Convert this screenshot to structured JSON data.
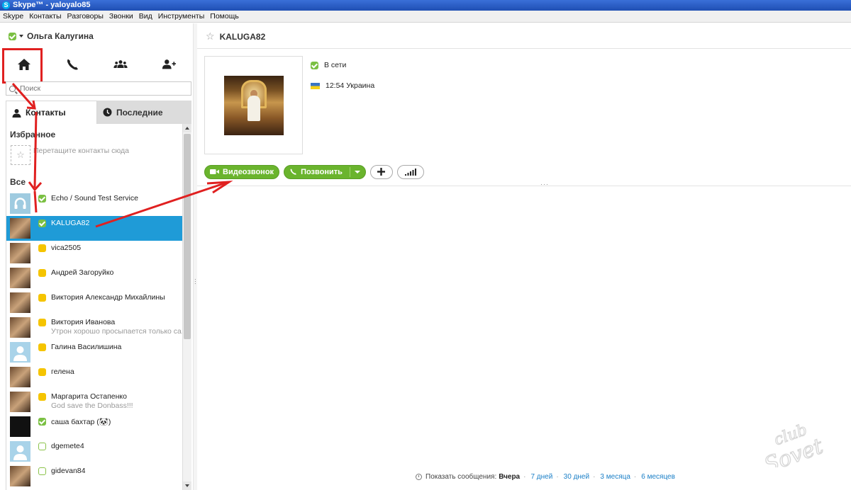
{
  "window": {
    "title": "Skype™ - yaloyalo85"
  },
  "menu": [
    "Skype",
    "Контакты",
    "Разговоры",
    "Звонки",
    "Вид",
    "Инструменты",
    "Помощь"
  ],
  "profile": {
    "name": "Ольга Калугина",
    "status": "online"
  },
  "nav": [
    {
      "id": "home",
      "icon": "home-icon"
    },
    {
      "id": "call",
      "icon": "phone-icon"
    },
    {
      "id": "groups",
      "icon": "group-icon"
    },
    {
      "id": "add",
      "icon": "add-contact-icon"
    }
  ],
  "search": {
    "placeholder": "Поиск"
  },
  "tabs": {
    "contacts": "Контакты",
    "recent": "Последние"
  },
  "favorites": {
    "title": "Избранное",
    "hint": "Перетащите контакты сюда"
  },
  "all_title": "Все",
  "contacts": [
    {
      "name": "Echo / Sound Test Service",
      "mood": "",
      "status": "online",
      "avatar": "headset"
    },
    {
      "name": "KALUGA82",
      "mood": "",
      "status": "online",
      "avatar": "photo",
      "selected": true
    },
    {
      "name": "vica2505",
      "mood": "",
      "status": "away",
      "avatar": "photo"
    },
    {
      "name": "Андрей Загоруйко",
      "mood": "",
      "status": "away",
      "avatar": "photo"
    },
    {
      "name": "Виктория Александр  Михайлины",
      "mood": "",
      "status": "away",
      "avatar": "photo"
    },
    {
      "name": "Виктория Иванова",
      "mood": "Утрон хорошо просыпается только са...",
      "status": "away",
      "avatar": "photo"
    },
    {
      "name": "Галина Василишина",
      "mood": "",
      "status": "away",
      "avatar": "default"
    },
    {
      "name": "гелена",
      "mood": "",
      "status": "away",
      "avatar": "photo"
    },
    {
      "name": "Маргарита Остапенко",
      "mood": "God save the Donbass!!!",
      "status": "away",
      "avatar": "photo"
    },
    {
      "name": "саша бахтар (🐼)",
      "mood": "",
      "status": "online",
      "avatar": "dark"
    },
    {
      "name": "dgemete4",
      "mood": "",
      "status": "offline",
      "avatar": "default"
    },
    {
      "name": "gidevan84",
      "mood": "",
      "status": "offline",
      "avatar": "photo"
    }
  ],
  "chat": {
    "title": "KALUGA82",
    "presence": "В сети",
    "local_time": "12:54 Украина",
    "video_button": "Видеозвонок",
    "call_button": "Позвонить"
  },
  "history": {
    "label": "Показать сообщения:",
    "current": "Вчера",
    "options": [
      "7 дней",
      "30 дней",
      "3 месяца",
      "6 месяцев"
    ]
  },
  "watermark": "club Sovet",
  "colors": {
    "accent_blue": "#1f9bd7",
    "online_green": "#7bc043",
    "away_yellow": "#f5c400",
    "button_green": "#6ab42d",
    "annotation_red": "#e02020"
  }
}
